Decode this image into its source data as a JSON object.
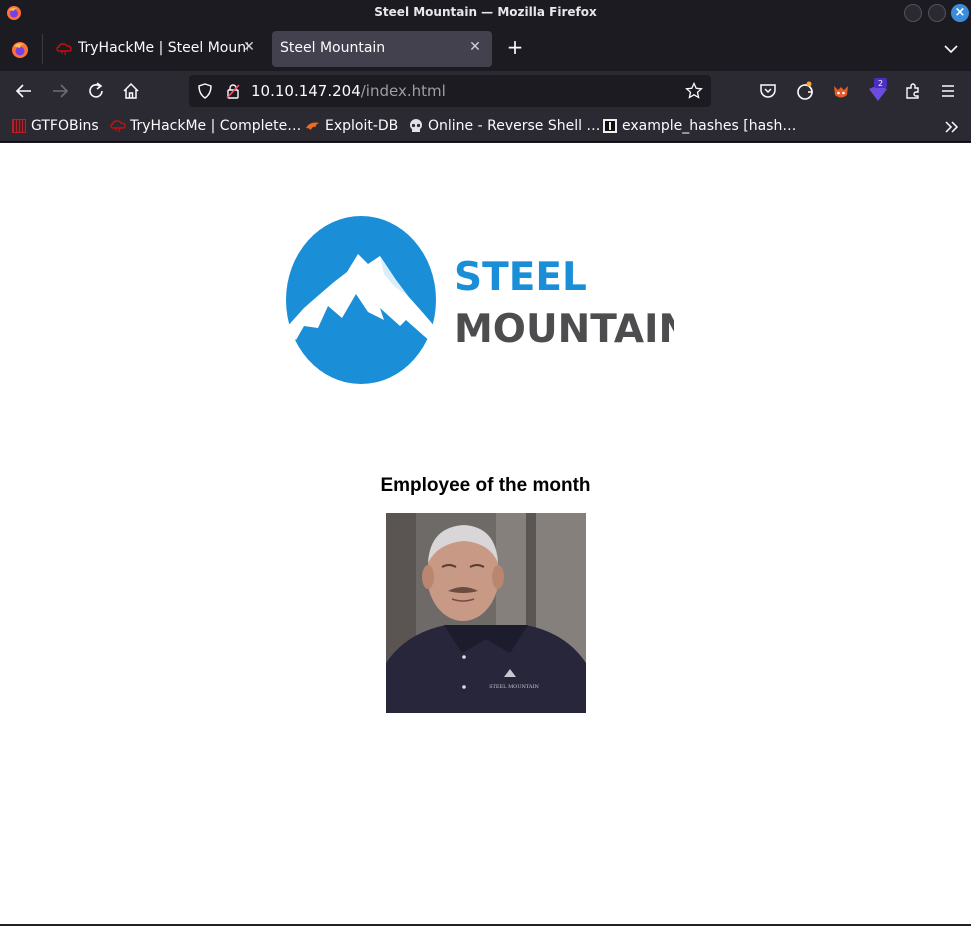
{
  "window": {
    "title": "Steel Mountain — Mozilla Firefox"
  },
  "tabs": [
    {
      "label": "TryHackMe | Steel Mountain",
      "active": false
    },
    {
      "label": "Steel Mountain",
      "active": true
    }
  ],
  "navbar": {
    "url_host": "10.10.147.204",
    "url_path": "/index.html",
    "badge_count": "2"
  },
  "bookmarks": [
    {
      "label": "GTFOBins",
      "icon": "gtfobins-icon"
    },
    {
      "label": "TryHackMe | Complete…",
      "icon": "tryhackme-icon"
    },
    {
      "label": "Exploit-DB",
      "icon": "exploitdb-icon"
    },
    {
      "label": "Online - Reverse Shell …",
      "icon": "skull-icon"
    },
    {
      "label": "example_hashes [hash…",
      "icon": "hashcat-icon"
    }
  ],
  "page": {
    "logo_line1": "STEEL",
    "logo_line2": "MOUNTAIN",
    "employee_heading": "Employee of the month",
    "shirt_logo_text": "STEEL MOUNTAIN"
  },
  "colors": {
    "brand_blue": "#1a8fd8",
    "brand_gray": "#4d4d4f",
    "chrome_dark": "#1c1b22",
    "chrome_mid": "#2b2a33",
    "active_tab": "#42414d"
  }
}
